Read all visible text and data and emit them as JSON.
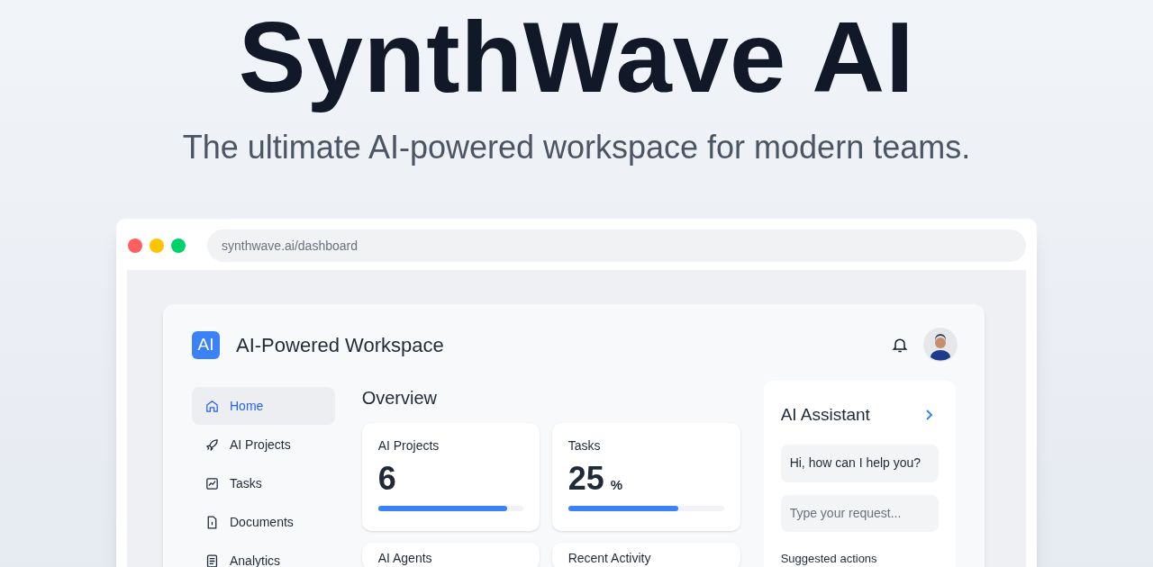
{
  "hero": {
    "title": "SynthWave AI",
    "subtitle": "The ultimate AI-powered workspace for modern teams."
  },
  "browser": {
    "url": "synthwave.ai/dashboard"
  },
  "app": {
    "logo": "AI",
    "title": "AI-Powered Workspace"
  },
  "sidebar": {
    "items": [
      {
        "label": "Home",
        "selected": true
      },
      {
        "label": "AI Projects",
        "selected": false
      },
      {
        "label": "Tasks",
        "selected": false
      },
      {
        "label": "Documents",
        "selected": false
      },
      {
        "label": "Analytics",
        "selected": false
      }
    ]
  },
  "overview": {
    "title": "Overview",
    "cards": [
      {
        "label": "AI Projects",
        "value": "6",
        "level": 0.89
      },
      {
        "label": "Tasks",
        "value": "25",
        "unit": "%",
        "level": 0.71
      },
      {
        "label": "AI Agents"
      },
      {
        "label": "Recent Activity"
      }
    ]
  },
  "assistant": {
    "title": "AI Assistant",
    "message": "Hi, how can I help you?",
    "placeholder": "Type your request...",
    "section": "Suggested actions"
  }
}
